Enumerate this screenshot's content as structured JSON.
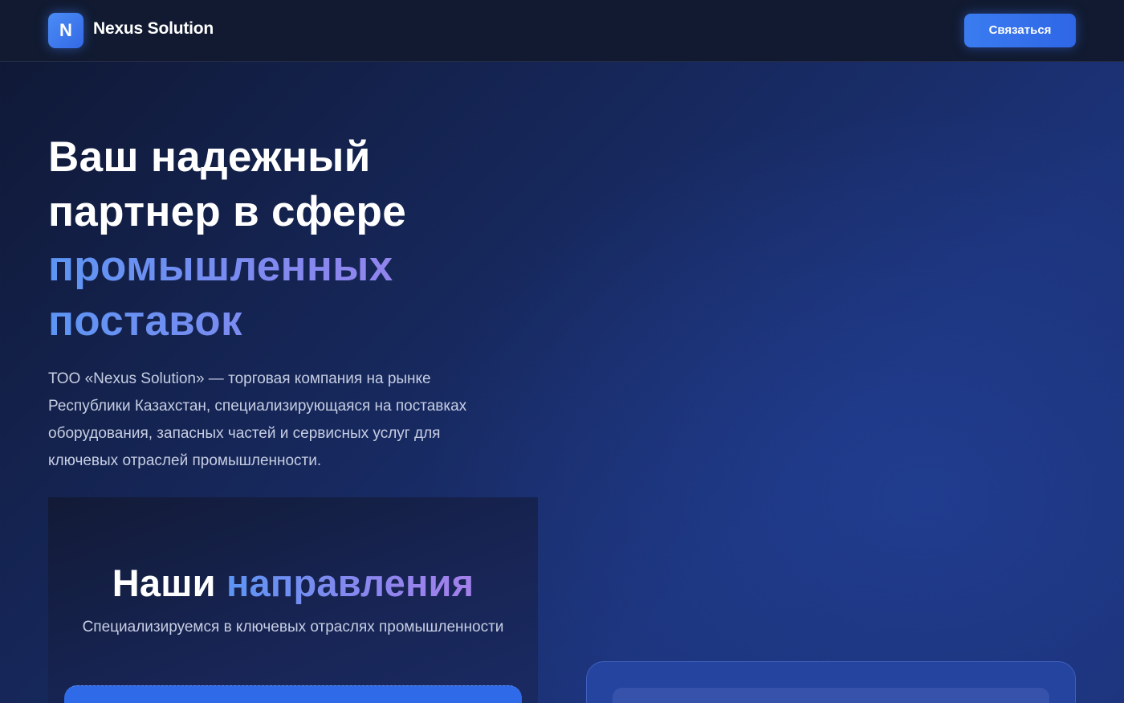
{
  "header": {
    "logo_letter": "N",
    "brand_name": "Nexus Solution",
    "contact_label": "Связаться"
  },
  "hero": {
    "title_line1": "Ваш надежный",
    "title_line2": "партнер в сфере",
    "title_accent_line1": "промышленных",
    "title_accent_line2": "поставок",
    "description": "ТОО «Nexus Solution» — торговая компания на рынке Республики Казахстан, специализирующаяся на поставках оборудования, запасных частей и сервисных услуг для ключевых отраслей промышленности."
  },
  "directions": {
    "title_plain": "Наши",
    "title_accent": "направления",
    "subtitle": "Специализируемся в ключевых отраслях промышленности"
  },
  "colors": {
    "accent_blue": "#3a7cf0",
    "gradient_start": "#5c95f4",
    "gradient_end": "#a480ea",
    "nav_bg": "#111a30"
  }
}
